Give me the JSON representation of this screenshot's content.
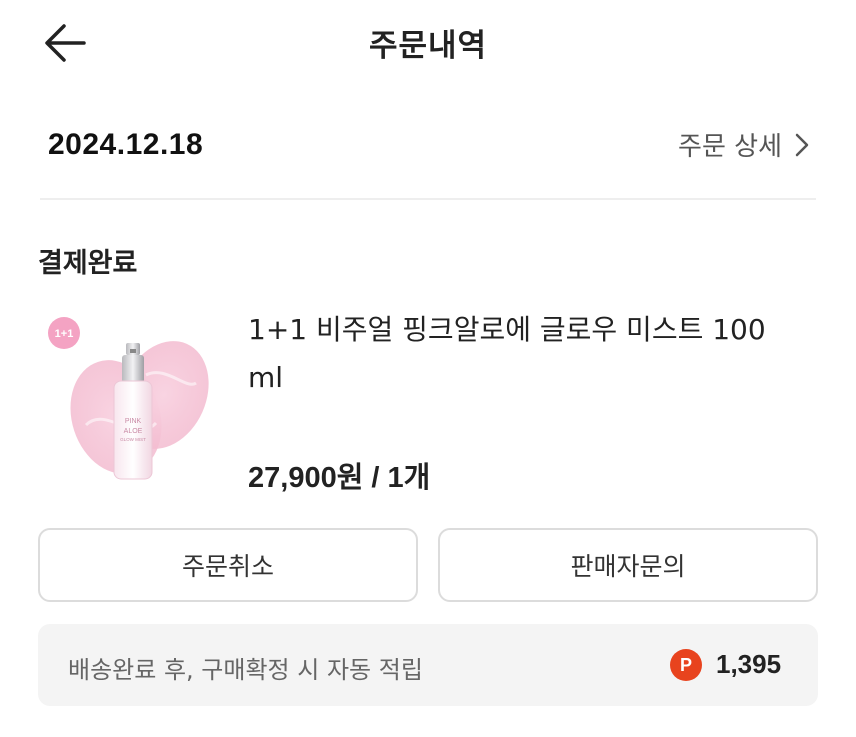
{
  "header": {
    "title": "주문내역",
    "back_icon": "arrow-left-icon"
  },
  "order": {
    "date": "2024.12.18",
    "detail_link_label": "주문 상세",
    "detail_link_icon": "chevron-right-icon",
    "status": "결제완료"
  },
  "product": {
    "badge": "1+1",
    "name": "1+1 비주얼 핑크알로에 글로우 미스트 100 ml",
    "price_line": "27,900원 / 1개",
    "label_lines": [
      "PINK",
      "ALOE",
      "GLOW MIST"
    ],
    "accent_color": "#f7b8d0"
  },
  "actions": {
    "cancel_label": "주문취소",
    "inquiry_label": "판매자문의"
  },
  "points": {
    "text": "배송완료 후, 구매확정 시 자동 적립",
    "icon_letter": "P",
    "icon_color": "#e8431e",
    "value": "1,395"
  }
}
